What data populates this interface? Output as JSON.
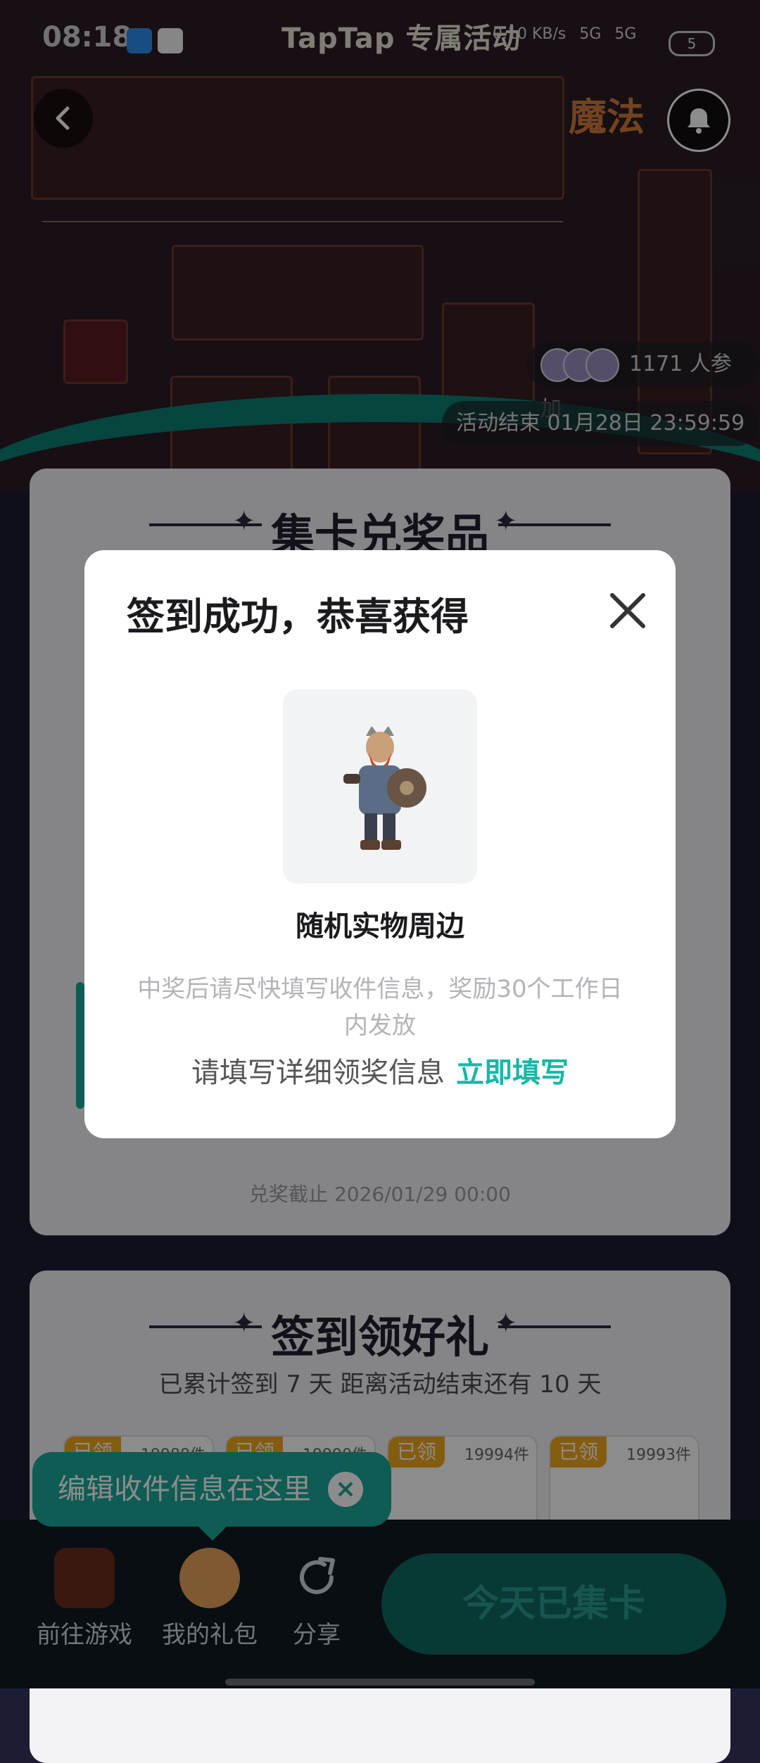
{
  "status_bar": {
    "time": "08:18",
    "network_speed": "0.10 KB/s",
    "signal_1": "5G",
    "signal_2": "5G",
    "battery": "5"
  },
  "header": {
    "title": "TapTap 专属活动",
    "game_logo_text": "魔法"
  },
  "activity": {
    "participants": "1171 人参加",
    "end_time": "活动结束 01月28日 23:59:59"
  },
  "card_collect": {
    "title": "集卡兑奖品",
    "deadline": "兑奖截止 2026/01/29 00:00"
  },
  "card_sign": {
    "title": "签到领好礼",
    "stats": "已累计签到 7 天  距离活动结束还有 10 天",
    "gifts": [
      {
        "tag": "已领",
        "count": "19988件"
      },
      {
        "tag": "已领",
        "count": "19990件"
      },
      {
        "tag": "已领",
        "count": "19994件"
      },
      {
        "tag": "已领",
        "count": "19993件"
      }
    ]
  },
  "tooltip": {
    "text": "编辑收件信息在这里"
  },
  "bottom_bar": {
    "tabs": [
      {
        "label": "前往游戏"
      },
      {
        "label": "我的礼包"
      },
      {
        "label": "分享"
      }
    ],
    "action_button": "今天已集卡"
  },
  "modal": {
    "title": "签到成功，恭喜获得",
    "prize_name": "随机实物周边",
    "note": "中奖后请尽快填写收件信息，奖励30个工作日内发放",
    "fill_prompt": "请填写详细领奖信息",
    "fill_link": "立即填写"
  },
  "colors": {
    "accent": "#15b8a6",
    "tag": "#f0a81d",
    "tooltip": "#1aa89a"
  }
}
